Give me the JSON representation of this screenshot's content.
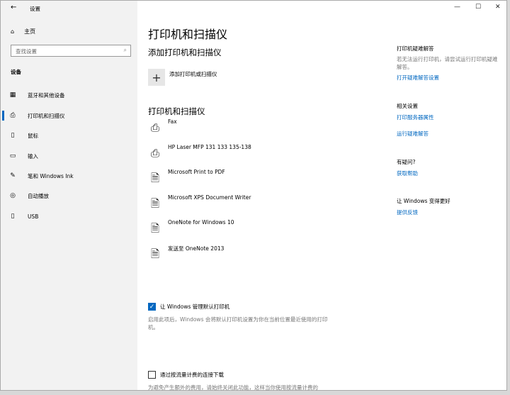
{
  "window": {
    "title": "设置",
    "minimize": "—",
    "maximize": "☐",
    "close": "✕"
  },
  "sidebar": {
    "back": "←",
    "home": "主页",
    "search_placeholder": "查找设置",
    "section": "设备",
    "items": [
      {
        "label": "蓝牙和其他设备",
        "icon": "bluetooth-devices-icon"
      },
      {
        "label": "打印机和扫描仪",
        "icon": "printer-icon"
      },
      {
        "label": "鼠标",
        "icon": "mouse-icon"
      },
      {
        "label": "输入",
        "icon": "keyboard-icon"
      },
      {
        "label": "笔和 Windows Ink",
        "icon": "pen-icon"
      },
      {
        "label": "自动播放",
        "icon": "autoplay-icon"
      },
      {
        "label": "USB",
        "icon": "usb-icon"
      }
    ]
  },
  "main": {
    "title": "打印机和扫描仪",
    "add_heading": "添加打印机和扫描仪",
    "add_label": "添加打印机或扫描仪",
    "list_heading": "打印机和扫描仪",
    "printers": [
      "Fax",
      "HP Laser MFP 131 133 135-138",
      "Microsoft Print to PDF",
      "Microsoft XPS Document Writer",
      "OneNote for Windows 10",
      "发送至 OneNote 2013"
    ],
    "default_printer": {
      "label": "让 Windows 管理默认打印机",
      "checked": true,
      "desc": "启用此项后，Windows 会将默认打印机设置为你在当前位置最近使用的打印机。"
    },
    "metered": {
      "label": "通过按流量计费的连接下载",
      "checked": false,
      "desc": "为避免产生额外的费用，请始终关闭此功能，这样当你使用按流量计费的"
    }
  },
  "right": {
    "troubleshoot_title": "打印机疑难解答",
    "troubleshoot_desc": "若无法运行打印机，请尝试运行打印机疑难解答。",
    "troubleshoot_link": "打开疑难解答设置",
    "related_title": "相关设置",
    "related_links": [
      "打印服务器属性",
      "运行疑难解答"
    ],
    "question_title": "有疑问?",
    "help_link": "获取帮助",
    "better_title": "让 Windows 变得更好",
    "feedback_link": "提供反馈"
  }
}
